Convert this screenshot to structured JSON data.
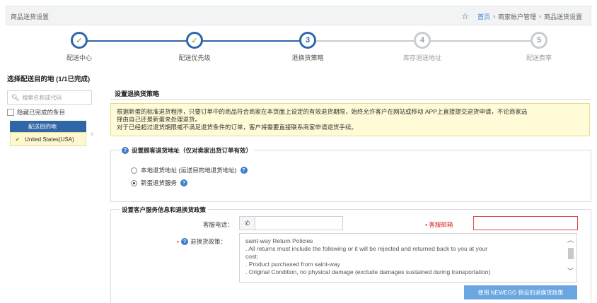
{
  "header": {
    "title": "商品送货设置",
    "breadcrumbs": [
      "首页",
      "商家帐户管理",
      "商品送货设置"
    ],
    "separator": "›"
  },
  "steps": [
    {
      "label": "配送中心",
      "status": "done",
      "marker": "✓"
    },
    {
      "label": "配送优先级",
      "status": "done",
      "marker": "✓"
    },
    {
      "label": "退换货策略",
      "status": "current",
      "marker": "3"
    },
    {
      "label": "库存退送地址",
      "status": "pending",
      "marker": "4"
    },
    {
      "label": "配送费率",
      "status": "pending",
      "marker": "5"
    }
  ],
  "left_panel": {
    "title": "选择配送目的地 (1/1已完成)",
    "search_placeholder": "搜索名称或代码",
    "hide_completed_label": "隐藏已完成的条目",
    "dest_header": "配送目的地",
    "destinations": [
      {
        "name": "United States(USA)",
        "completed": true
      }
    ]
  },
  "main": {
    "section_title": "设置退换货策略",
    "notice_lines": [
      "根据新蛋的标准退货程序，只要订单中的商品符合商家在本页面上设定的有效退货期限，始终允许客户在网站或移动 APP上直接提交退货申请，不论商家选",
      "择由自己还是新蛋来处理退货。",
      "对于已经超过退货期限或不满足退货条件的订单，客户将需要直接联系商家申请退货手续。"
    ],
    "return_address": {
      "title": "设置顾客退货地址（仅对卖家出货订单有效）",
      "options": [
        {
          "label": "本地退货地址 (运送目的地退货地址)",
          "selected": false
        },
        {
          "label": "新蛋退货服务",
          "selected": true
        }
      ]
    },
    "service": {
      "title": "设置客户服务信息和退换货政策",
      "phone_label": "客服电话：",
      "phone_value": "",
      "email_label": "客服邮箱",
      "email_value": "",
      "policy_label": "退换货政策：",
      "policy_lines": [
        "saint-way Return Policies",
        ".      All returns must include the following or it will be rejected and returned back to you at your",
        "cost:",
        ".      Product purchased from saint-way",
        ".      Original Condition, no physical damage (exclude damages sustained during transportation)"
      ],
      "use_button_label": "使用 NEWEGG 预设的退换货政策"
    }
  },
  "colors": {
    "primary": "#2f66a8",
    "success": "#5aa620",
    "notice_bg": "#fffbd6",
    "error": "#e04848",
    "button": "#6aa6e0"
  }
}
